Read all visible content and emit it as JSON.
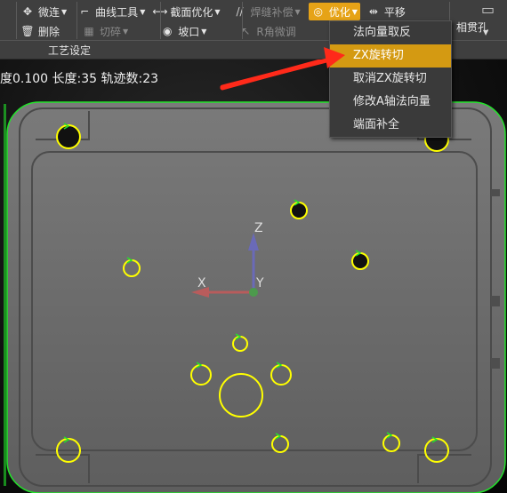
{
  "toolbar": {
    "row1": {
      "weilian": "微连",
      "quxian": "曲线工具",
      "jiemian": "截面优化",
      "hanfeng": "焊缝补偿",
      "youhua": "优化",
      "pingyi": "平移",
      "xiangguan": "相贯孔"
    },
    "row2": {
      "shanchu": "删除",
      "qiesui": "切碎",
      "pokou": "坡口",
      "rjiao": "R角微调"
    },
    "group_label": "工艺设定"
  },
  "status_text": "度0.100 长度:35 轨迹数:23",
  "menu": {
    "items": [
      "法向量取反",
      "ZX旋转切",
      "取消ZX旋转切",
      "修改A轴法向量",
      "端面补全"
    ],
    "active_index": 1
  },
  "axes": {
    "x": "X",
    "y": "Y",
    "z": "Z"
  },
  "colors": {
    "accent": "#e6a317",
    "contour": "#22e22a",
    "hole": "#ffff00",
    "arrow": "#ff2a1a"
  },
  "icons": [
    "move-icon",
    "curve-tool-icon",
    "section-optimize-icon",
    "weld-compensate-icon",
    "optimize-icon",
    "translate-icon",
    "delete-icon",
    "grid-icon",
    "bevel-icon",
    "r-corner-icon"
  ]
}
